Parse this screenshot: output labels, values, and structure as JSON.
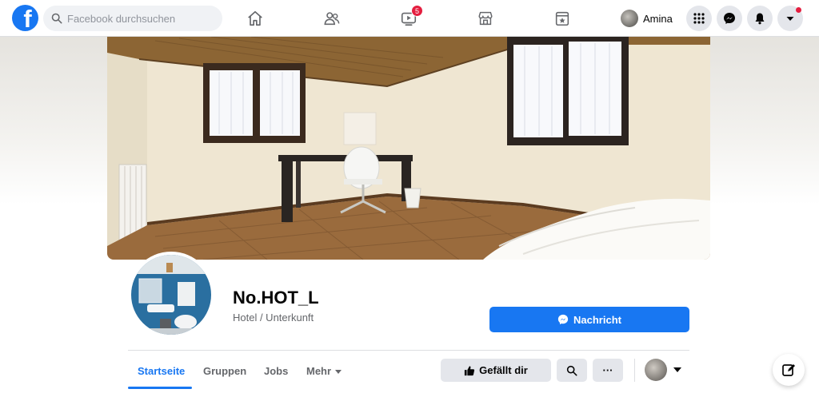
{
  "topbar": {
    "search_placeholder": "Facebook durchsuchen",
    "watch_badge": "5",
    "profile_name": "Amina"
  },
  "page": {
    "name": "No.HOT_L",
    "category": "Hotel / Unterkunft",
    "message_button": "Nachricht"
  },
  "tabs": [
    {
      "label": "Startseite",
      "active": true
    },
    {
      "label": "Gruppen",
      "active": false
    },
    {
      "label": "Jobs",
      "active": false
    },
    {
      "label": "Mehr",
      "active": false
    }
  ],
  "actions": {
    "like_label": "Gefällt dir",
    "more_label": "···"
  },
  "icons": [
    "facebook-logo",
    "search-icon",
    "home-icon",
    "friends-icon",
    "watch-icon",
    "marketplace-icon",
    "gaming-icon",
    "menu-grid-icon",
    "messenger-icon",
    "bell-icon",
    "account-caret-icon",
    "thumbs-up-icon",
    "compose-icon"
  ],
  "colors": {
    "brand_blue": "#1877f2",
    "badge_red": "#e41e3f",
    "nav_background": "#ffffff",
    "secondary_button": "#e4e6eb",
    "muted_text": "#65676b"
  }
}
